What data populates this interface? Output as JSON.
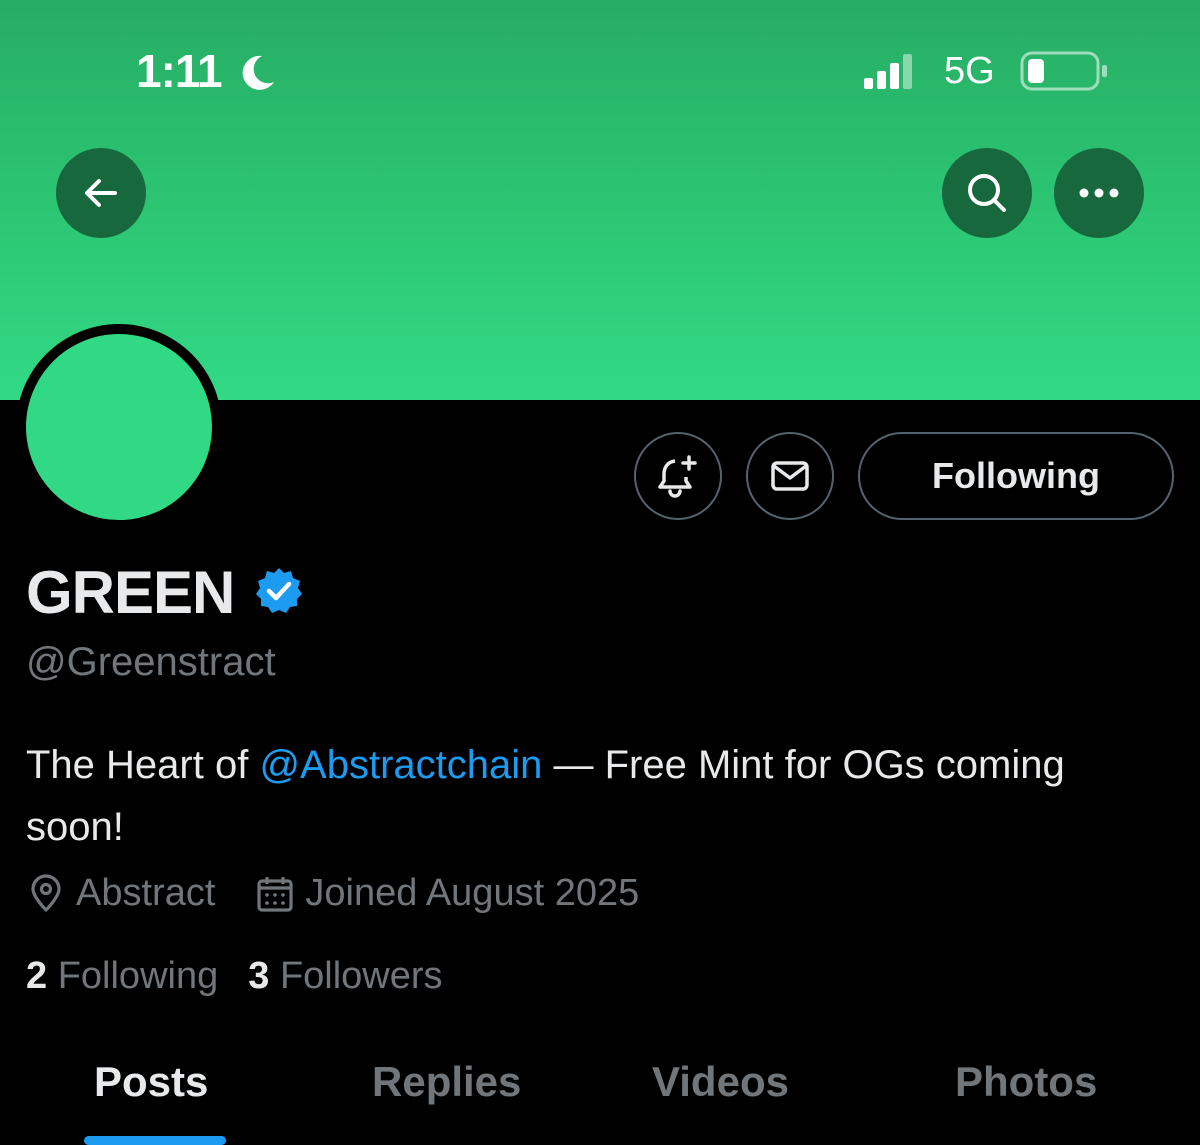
{
  "status_bar": {
    "time": "1:11",
    "network": "5G"
  },
  "header": {
    "banner_color": "#2fd07e",
    "back_icon": "arrow-left-icon",
    "search_icon": "search-icon",
    "more_icon": "more-horizontal-icon"
  },
  "profile": {
    "avatar_color": "#32d985",
    "display_name": "GREEN",
    "verified": true,
    "handle": "@Greenstract",
    "bio_prefix": "The Heart of ",
    "bio_mention": "@Abstractchain",
    "bio_suffix": " — Free Mint for OGs coming soon!",
    "location": "Abstract",
    "joined": "Joined August 2025",
    "following_count": "2",
    "following_label": "Following",
    "followers_count": "3",
    "followers_label": "Followers"
  },
  "actions": {
    "notify_icon": "bell-plus-icon",
    "message_icon": "envelope-icon",
    "following_button": "Following"
  },
  "tabs": [
    {
      "label": "Posts",
      "active": true
    },
    {
      "label": "Replies",
      "active": false
    },
    {
      "label": "Videos",
      "active": false
    },
    {
      "label": "Photos",
      "active": false
    }
  ],
  "colors": {
    "accent": "#1d9bf0",
    "background": "#000000",
    "muted_text": "#71767b"
  }
}
